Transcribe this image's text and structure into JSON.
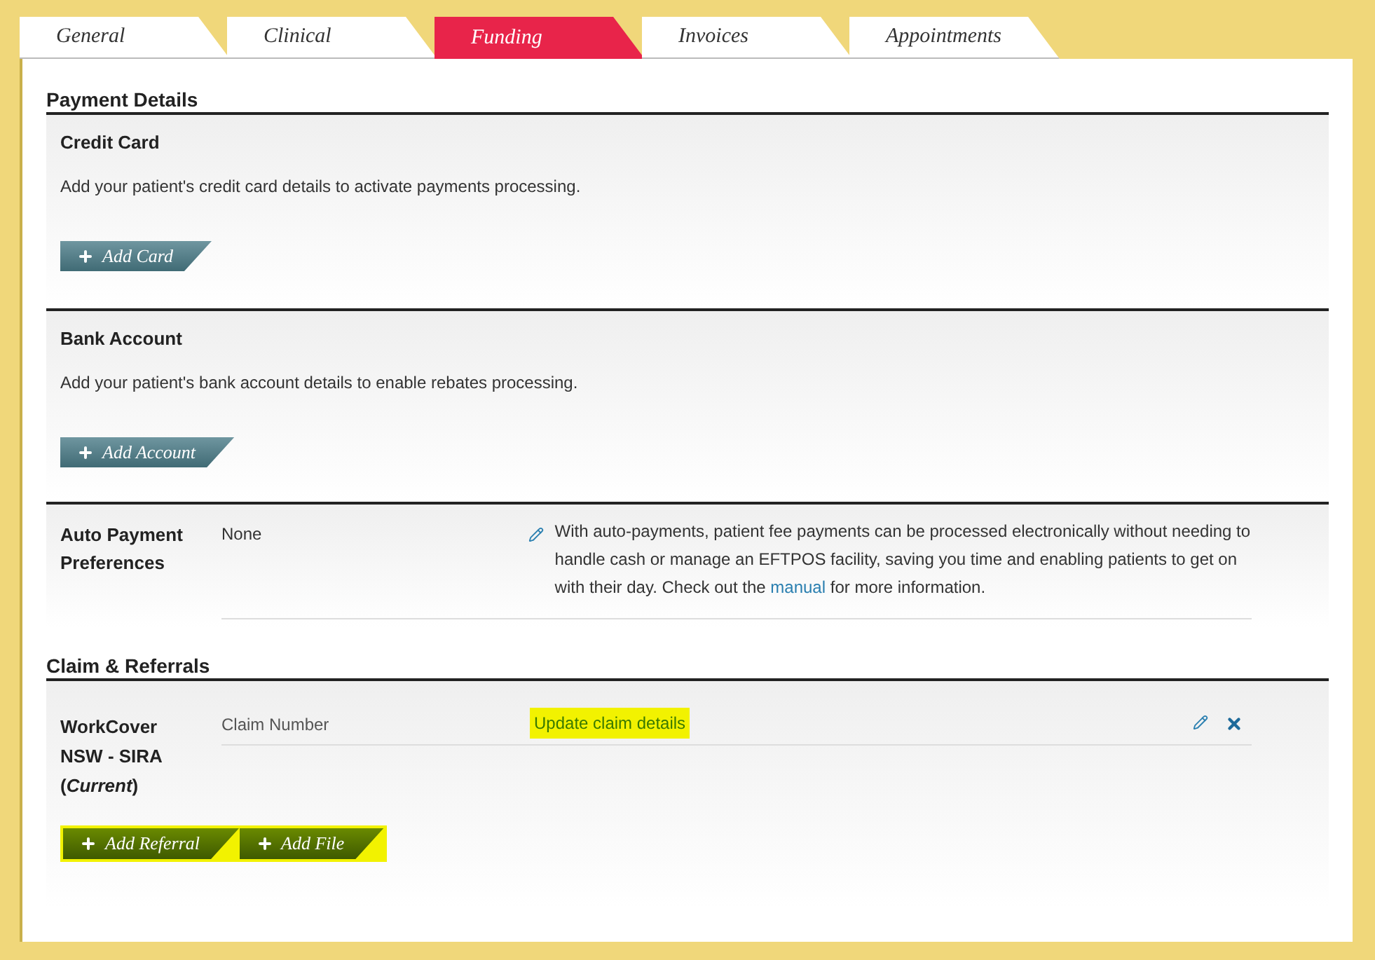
{
  "tabs": [
    {
      "label": "General",
      "selected": false
    },
    {
      "label": "Clinical",
      "selected": false
    },
    {
      "label": "Funding",
      "selected": true
    },
    {
      "label": "Invoices",
      "selected": false
    },
    {
      "label": "Appointments",
      "selected": false
    }
  ],
  "payment_details": {
    "title": "Payment Details",
    "sections": [
      {
        "title": "Credit Card",
        "description": "Add your patient's credit card details to activate payments processing.",
        "button": "Add Card"
      },
      {
        "title": "Bank Account",
        "description": "Add your patient's bank account details to enable rebates processing.",
        "button": "Add Account"
      }
    ],
    "auto_payment": {
      "label": "Auto Payment Preferences",
      "value": "None",
      "info_before": "With auto-payments, patient fee payments can be processed electronically without needing to handle cash or manage an EFTPOS facility, saving you time and enabling patients to get on with their day. Check out the",
      "link": "manual",
      "info_after": "for more information."
    }
  },
  "claims": {
    "title": "Claim & Referrals",
    "claim": {
      "name": "WorkCover NSW - SIRA",
      "status": "(*Current*)",
      "field": "Claim Number",
      "link": {
        "label": "Update claim details",
        "highlighted": true
      }
    },
    "buttons": [
      {
        "label": "Add Referral",
        "highlighted": true
      },
      {
        "label": "Add File",
        "highlighted": true
      }
    ]
  }
}
